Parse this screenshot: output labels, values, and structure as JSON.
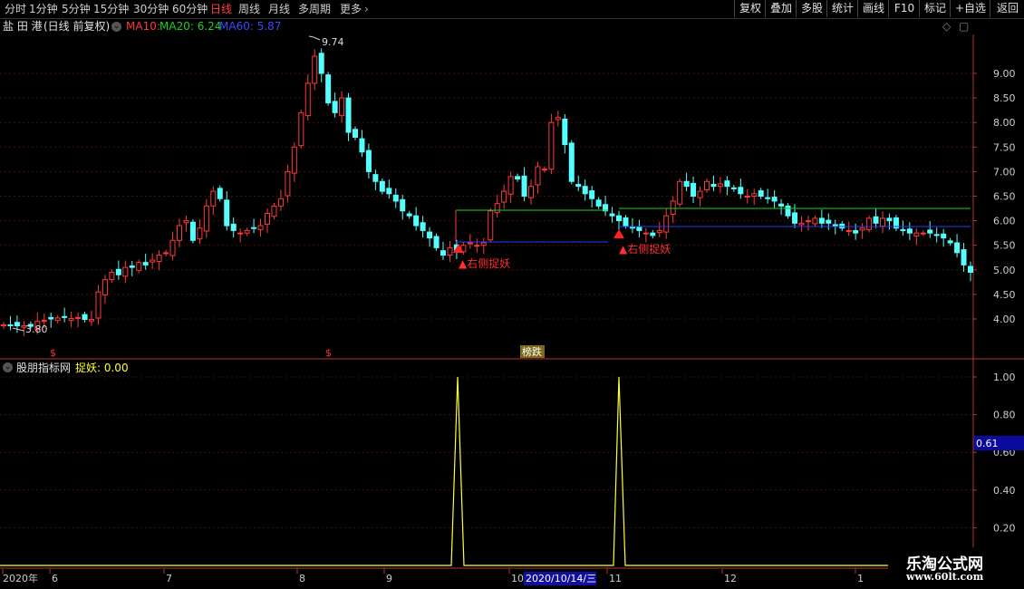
{
  "toolbar": {
    "timeframes": [
      "分时",
      "1分钟",
      "5分钟",
      "15分钟",
      "30分钟",
      "60分钟",
      "日线",
      "周线",
      "月线",
      "多周期",
      "更多"
    ],
    "active_timeframe": "日线",
    "right_buttons": [
      "复权",
      "叠加",
      "多股",
      "统计",
      "画线",
      "F10",
      "标记",
      "+自选",
      "返回"
    ]
  },
  "stock": {
    "name": "盐 田 港",
    "mode": "(日线 前复权)",
    "ma10_label": "MA10:",
    "ma20_label": "MA20: 6.24",
    "ma60_label": "MA60: 5.87"
  },
  "main_chart": {
    "y_ticks": [
      "9.00",
      "8.50",
      "8.00",
      "7.50",
      "7.00",
      "6.50",
      "6.00",
      "5.50",
      "5.00",
      "4.50",
      "4.00"
    ],
    "high_label": "9.74",
    "low_label": "3.80",
    "signal_label": "▲右侧捉妖",
    "badge_label": "榜跌",
    "dollar_marks": [
      "$",
      "$"
    ],
    "colors": {
      "up": "#ff3a3a",
      "down": "#54ffff",
      "ma20": "#1fd11f",
      "ma60": "#2a3aff",
      "signal": "#ff2020"
    }
  },
  "sub_chart": {
    "indicator_name": "股朋指标网",
    "indicator_label": "捉妖: 0.00",
    "y_ticks": [
      "1.00",
      "0.80",
      "0.60",
      "0.40",
      "0.20"
    ],
    "cursor_value": "0.61",
    "line_color": "#ffff33"
  },
  "x_axis": {
    "labels": [
      "2020年",
      "6",
      "7",
      "8",
      "9",
      "10",
      "11",
      "12",
      "1"
    ],
    "cursor_date": "2020/10/14/三"
  },
  "watermark": {
    "line1": "乐淘公式网",
    "line2": "www.60lt.com"
  },
  "chart_data": [
    {
      "type": "candlestick",
      "title": "盐 田 港",
      "y_ticks": [
        4.0,
        4.5,
        5.0,
        5.5,
        6.0,
        6.5,
        7.0,
        7.5,
        8.0,
        8.5,
        9.0
      ],
      "ylim": [
        3.45,
        10.05
      ],
      "high": 9.74,
      "low": 3.8,
      "ma20_last": 6.24,
      "ma60_last": 5.87,
      "x_labels": [
        "2020年",
        "6",
        "7",
        "8",
        "9",
        "10",
        "11",
        "12",
        "1"
      ],
      "signals": [
        "右侧捉妖",
        "右侧捉妖"
      ],
      "close_path": [
        3.88,
        3.87,
        3.86,
        3.86,
        3.85,
        3.95,
        3.97,
        4.0,
        4.02,
        4.03,
        4.01,
        4.03,
        3.99,
        3.99,
        4.55,
        4.8,
        4.95,
        4.9,
        5.05,
        5.05,
        5.15,
        5.1,
        5.2,
        5.3,
        5.35,
        5.6,
        5.9,
        6.0,
        5.6,
        5.85,
        6.3,
        6.6,
        6.45,
        5.9,
        5.8,
        5.75,
        5.8,
        5.85,
        5.9,
        6.15,
        6.3,
        6.45,
        7.0,
        7.5,
        8.2,
        8.8,
        9.35,
        9.0,
        8.4,
        8.2,
        8.5,
        7.8,
        7.7,
        7.4,
        7.0,
        6.8,
        6.6,
        6.55,
        6.4,
        6.2,
        6.1,
        5.9,
        5.8,
        5.65,
        5.45,
        5.3,
        5.45,
        5.4,
        5.5,
        5.55,
        5.5,
        5.55,
        6.2,
        6.35,
        6.6,
        6.9,
        6.85,
        6.5,
        6.7,
        7.1,
        7.05,
        8.0,
        8.1,
        7.55,
        6.8,
        6.7,
        6.55,
        6.45,
        6.3,
        6.2,
        6.1,
        6.0,
        5.9,
        5.85,
        5.8,
        5.75,
        5.7,
        5.8,
        6.1,
        6.4,
        6.8,
        6.7,
        6.5,
        6.6,
        6.8,
        6.7,
        6.75,
        6.7,
        6.65,
        6.55,
        6.5,
        6.55,
        6.5,
        6.45,
        6.4,
        6.3,
        6.1,
        5.95,
        5.95,
        6.0,
        6.05,
        5.95,
        5.95,
        5.9,
        5.85,
        5.8,
        5.75,
        5.85,
        6.05,
        5.95,
        6.05,
        6.0,
        5.85,
        5.8,
        5.75,
        5.75,
        5.75,
        5.75,
        5.7,
        5.65,
        5.55,
        5.35,
        5.1,
        4.95
      ]
    },
    {
      "type": "line",
      "series": [
        {
          "name": "捉妖",
          "spikes": [
            1.0,
            1.0
          ],
          "baseline": 0.0
        }
      ],
      "y_ticks": [
        0.2,
        0.4,
        0.6,
        0.8,
        1.0
      ],
      "ylim": [
        0.0,
        1.1
      ],
      "cursor_value": 0.61
    }
  ]
}
